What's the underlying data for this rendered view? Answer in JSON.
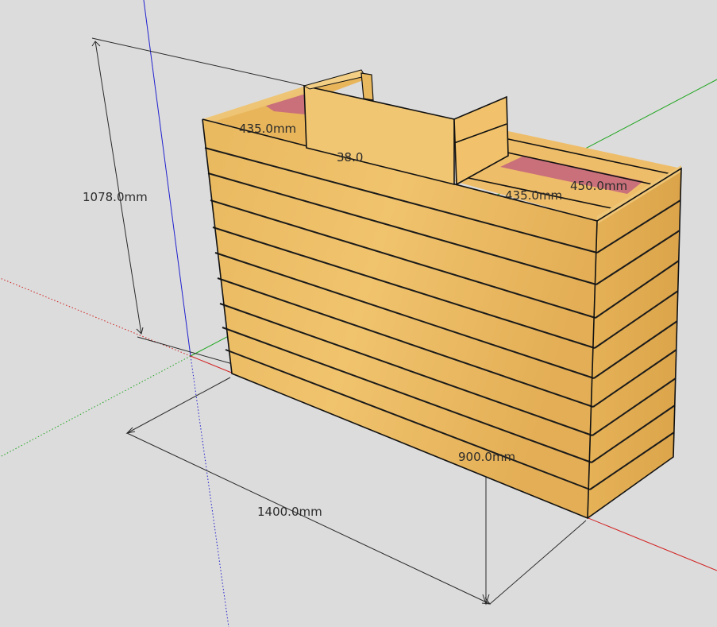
{
  "viewport": {
    "background": "#dcdcdc",
    "axes": {
      "x_color": "#d22020",
      "y_color": "#1fa51f",
      "z_color": "#2020d0"
    }
  },
  "model": {
    "wood_color": "#e8b55a",
    "inner_panel_color": "#c9707a"
  },
  "dimensions": {
    "height_total": "1078.0mm",
    "height_front": "900.0mm",
    "length": "1400.0mm",
    "inner_left": "435.0mm",
    "inner_right": "435.0mm",
    "inner_depth": "450.0mm",
    "thickness": "38.0"
  }
}
